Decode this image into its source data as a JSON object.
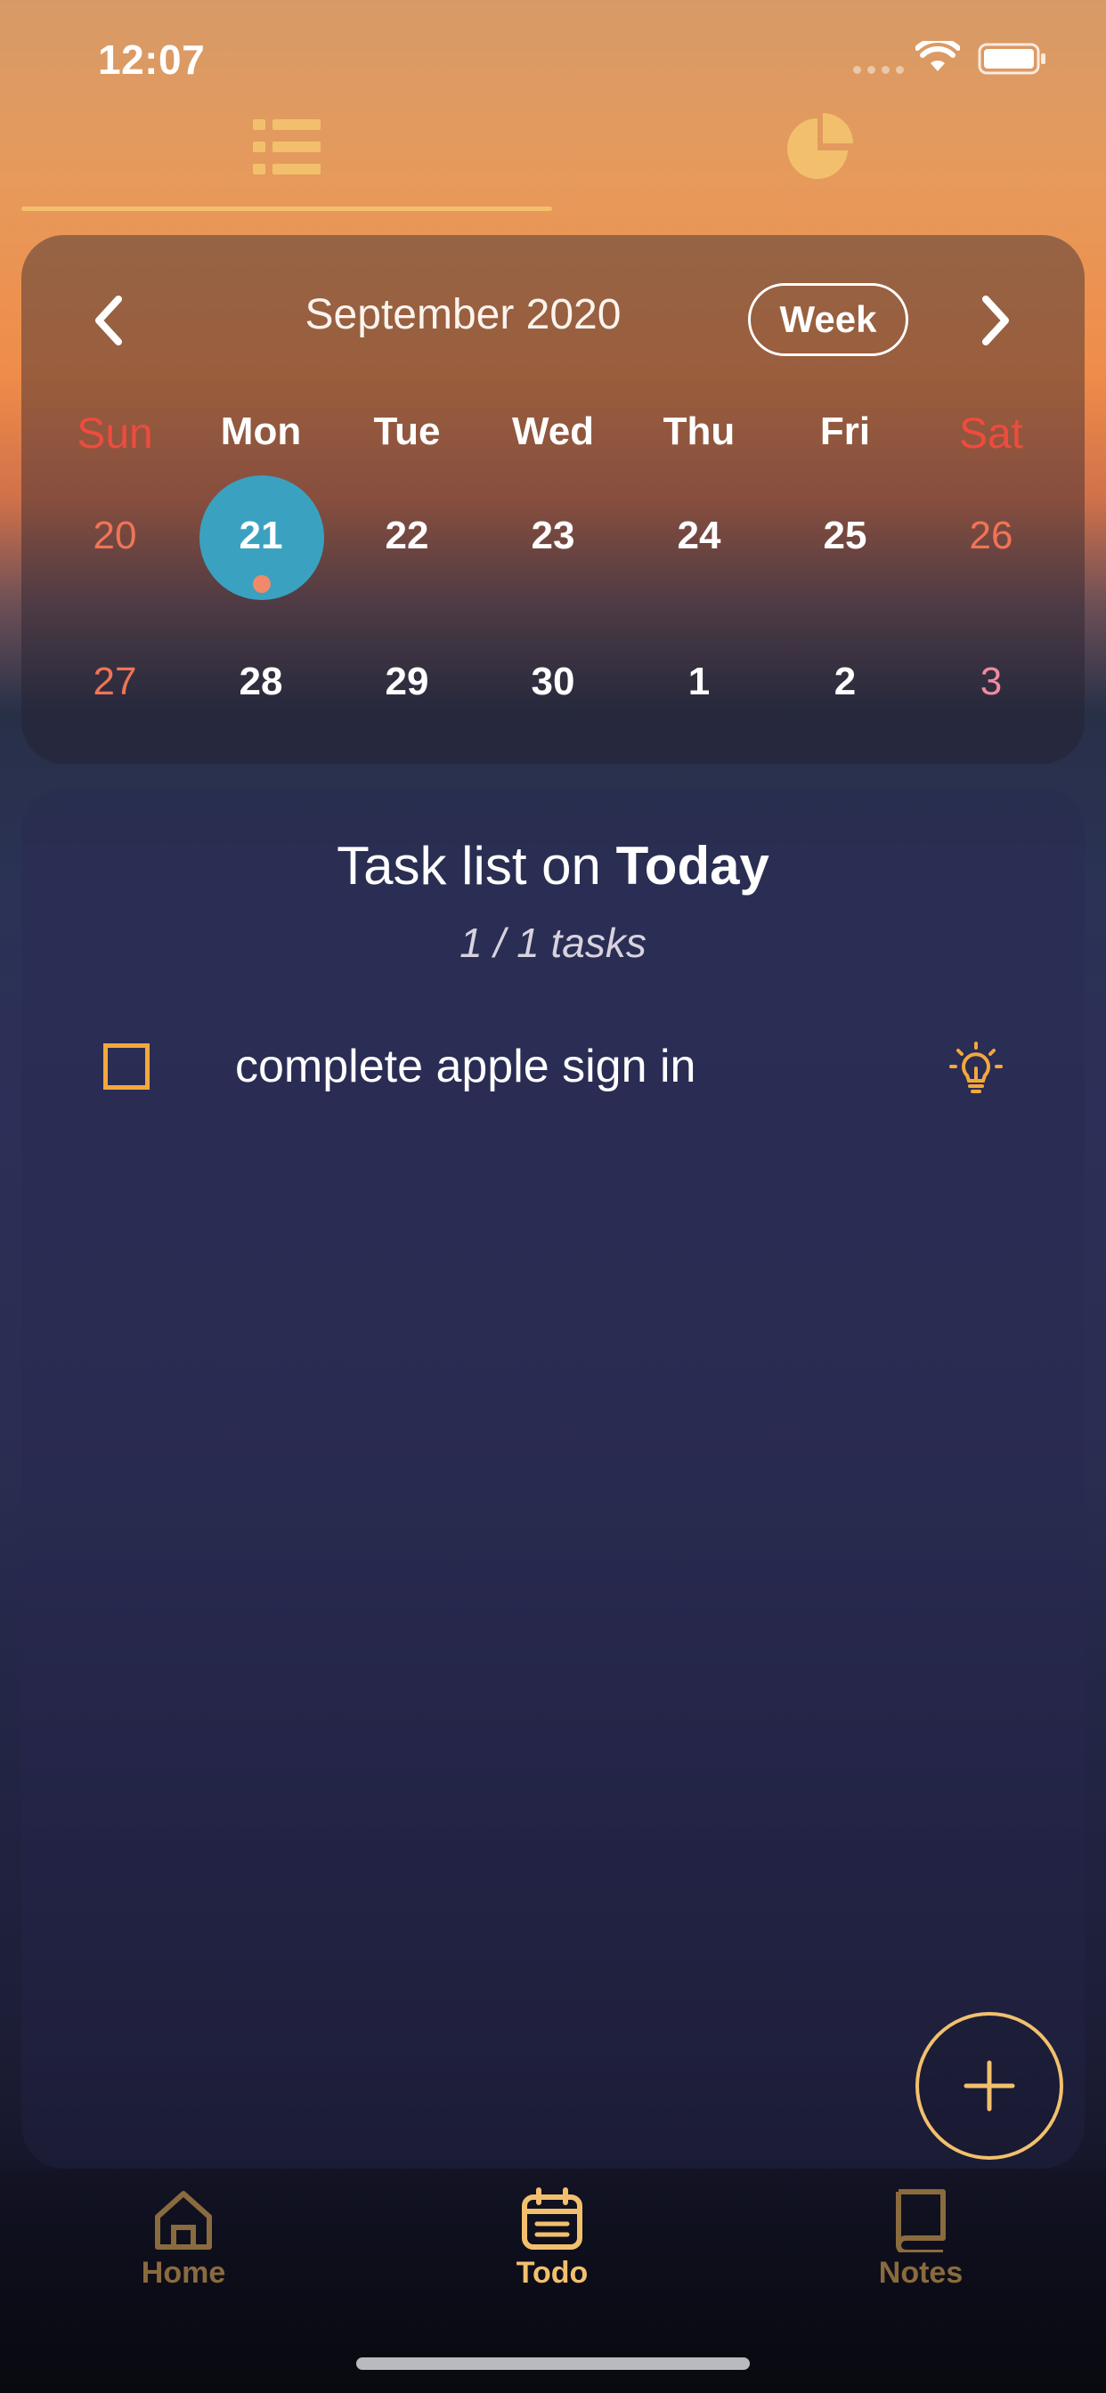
{
  "status_bar": {
    "time": "12:07"
  },
  "top_tabs": [
    {
      "name": "list",
      "icon": "list-icon",
      "selected": true
    },
    {
      "name": "stats",
      "icon": "pie-chart-icon",
      "selected": false
    }
  ],
  "calendar": {
    "month_label": "September 2020",
    "view_toggle_label": "Week",
    "weekdays": [
      "Sun",
      "Mon",
      "Tue",
      "Wed",
      "Thu",
      "Fri",
      "Sat"
    ],
    "weeks": [
      [
        "20",
        "21",
        "22",
        "23",
        "24",
        "25",
        "26"
      ],
      [
        "27",
        "28",
        "29",
        "30",
        "1",
        "2",
        "3"
      ]
    ],
    "selected_day": "21"
  },
  "tasks": {
    "title_prefix": "Task list on",
    "title_day": "Today",
    "count_label": "1 / 1 tasks",
    "items": [
      {
        "label": "complete apple sign in",
        "done": false
      }
    ]
  },
  "bottom_nav": {
    "items": [
      {
        "label": "Home",
        "icon": "home-icon",
        "active": false
      },
      {
        "label": "Todo",
        "icon": "calendar-icon",
        "active": true
      },
      {
        "label": "Notes",
        "icon": "book-icon",
        "active": false
      }
    ]
  },
  "colors": {
    "accent": "#f2c06d",
    "selected_day": "#3aa2c0",
    "weekend": "#ef4b3e",
    "checkbox": "#f3a83c"
  }
}
